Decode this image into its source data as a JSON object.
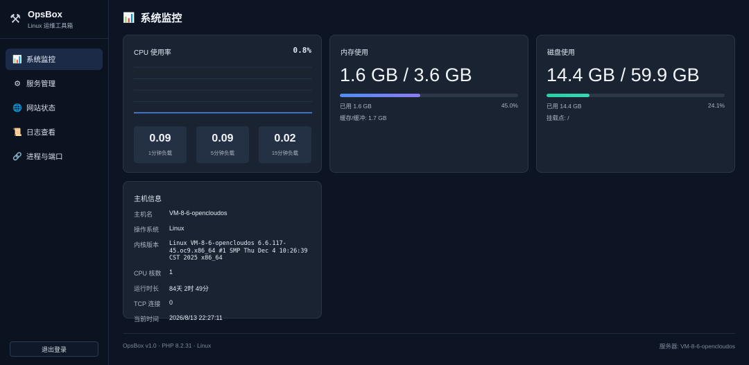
{
  "brand": {
    "name": "OpsBox",
    "subtitle": "Linux 运维工具箱",
    "icon": "tools-icon"
  },
  "nav": [
    {
      "label": "系统监控",
      "icon": "chart-icon",
      "glyph": "📊",
      "active": true
    },
    {
      "label": "服务管理",
      "icon": "gear-icon",
      "glyph": "⚙",
      "active": false
    },
    {
      "label": "网站状态",
      "icon": "globe-icon",
      "glyph": "🌐",
      "active": false
    },
    {
      "label": "日志查看",
      "icon": "scroll-icon",
      "glyph": "📜",
      "active": false
    },
    {
      "label": "进程与端口",
      "icon": "link-icon",
      "glyph": "🔗",
      "active": false
    }
  ],
  "logout_label": "退出登录",
  "page": {
    "title": "系统监控",
    "icon": "chart-icon"
  },
  "cpu": {
    "title": "CPU 使用率",
    "value": "0.8%",
    "loads": [
      {
        "value": "0.09",
        "label": "1分钟负载"
      },
      {
        "value": "0.09",
        "label": "5分钟负载"
      },
      {
        "value": "0.02",
        "label": "15分钟负载"
      }
    ]
  },
  "chart_data": {
    "type": "line",
    "title": "CPU 使用率",
    "series": [
      {
        "values": [
          0.8,
          0.8,
          0.8,
          0.8,
          0.8,
          0.8,
          0.8,
          0.8,
          0.8,
          0.8
        ]
      }
    ],
    "ylim": [
      0,
      100
    ],
    "grid": true,
    "color": "#4f8df5"
  },
  "memory": {
    "title": "内存使用",
    "big": "1.6 GB / 3.6 GB",
    "used": "已用 1.6 GB",
    "percent_label": "45.0%",
    "percent": 45.0,
    "extra": "缓存/缓冲: 1.7 GB"
  },
  "disk": {
    "title": "磁盘使用",
    "big": "14.4 GB / 59.9 GB",
    "used": "已用 14.4 GB",
    "percent_label": "24.1%",
    "percent": 24.1,
    "extra": "挂载点: /"
  },
  "host": {
    "title": "主机信息",
    "rows": [
      {
        "key": "主机名",
        "value": "VM-8-6-opencloudos"
      },
      {
        "key": "操作系统",
        "value": "Linux"
      },
      {
        "key": "内核版本",
        "value": "Linux VM-8-6-opencloudos 6.6.117-45.oc9.x86_64 #1 SMP Thu Dec 4 10:26:39 CST 2025 x86_64"
      },
      {
        "key": "CPU 核数",
        "value": "1"
      },
      {
        "key": "运行时长",
        "value": "84天 2时 49分"
      },
      {
        "key": "TCP 连接",
        "value": "0"
      },
      {
        "key": "当前时间",
        "value": "2026/8/13 22:27:11"
      }
    ]
  },
  "footer": {
    "left": "OpsBox v1.0 · PHP 8.2.31 · Linux",
    "right": "服务器: VM-8-6-opencloudos"
  }
}
